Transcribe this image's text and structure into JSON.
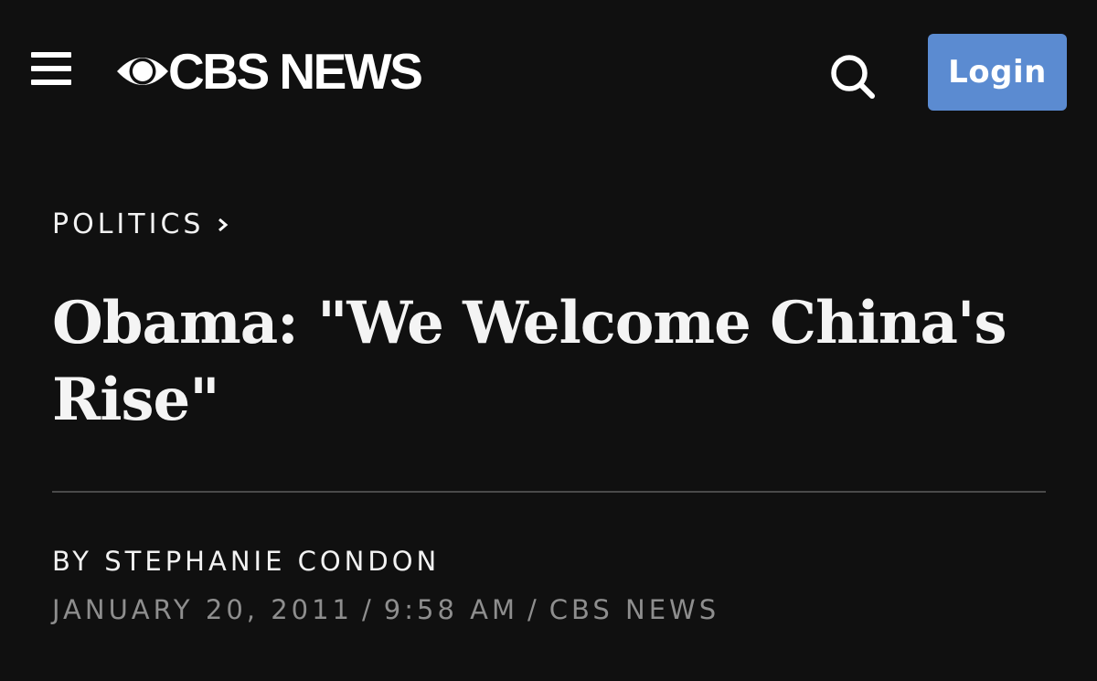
{
  "header": {
    "menu_icon": "hamburger-menu-icon",
    "logo_icon": "cbs-eye-icon",
    "logo_text": "CBS NEWS",
    "search_icon": "search-icon",
    "login_label": "Login",
    "login_color": "#5b8bd1"
  },
  "article": {
    "category": "POLITICS",
    "category_icon": "chevron-right-icon",
    "headline": "Obama: \"We Welcome China's Rise\"",
    "byline": "BY STEPHANIE CONDON",
    "date": "JANUARY 20, 2011",
    "time": "9:58 AM",
    "source": "CBS NEWS",
    "separator": "/"
  },
  "colors": {
    "background": "#101010",
    "text": "#ffffff",
    "meta_text": "#8e8e8e",
    "divider": "#4a4a4a"
  }
}
